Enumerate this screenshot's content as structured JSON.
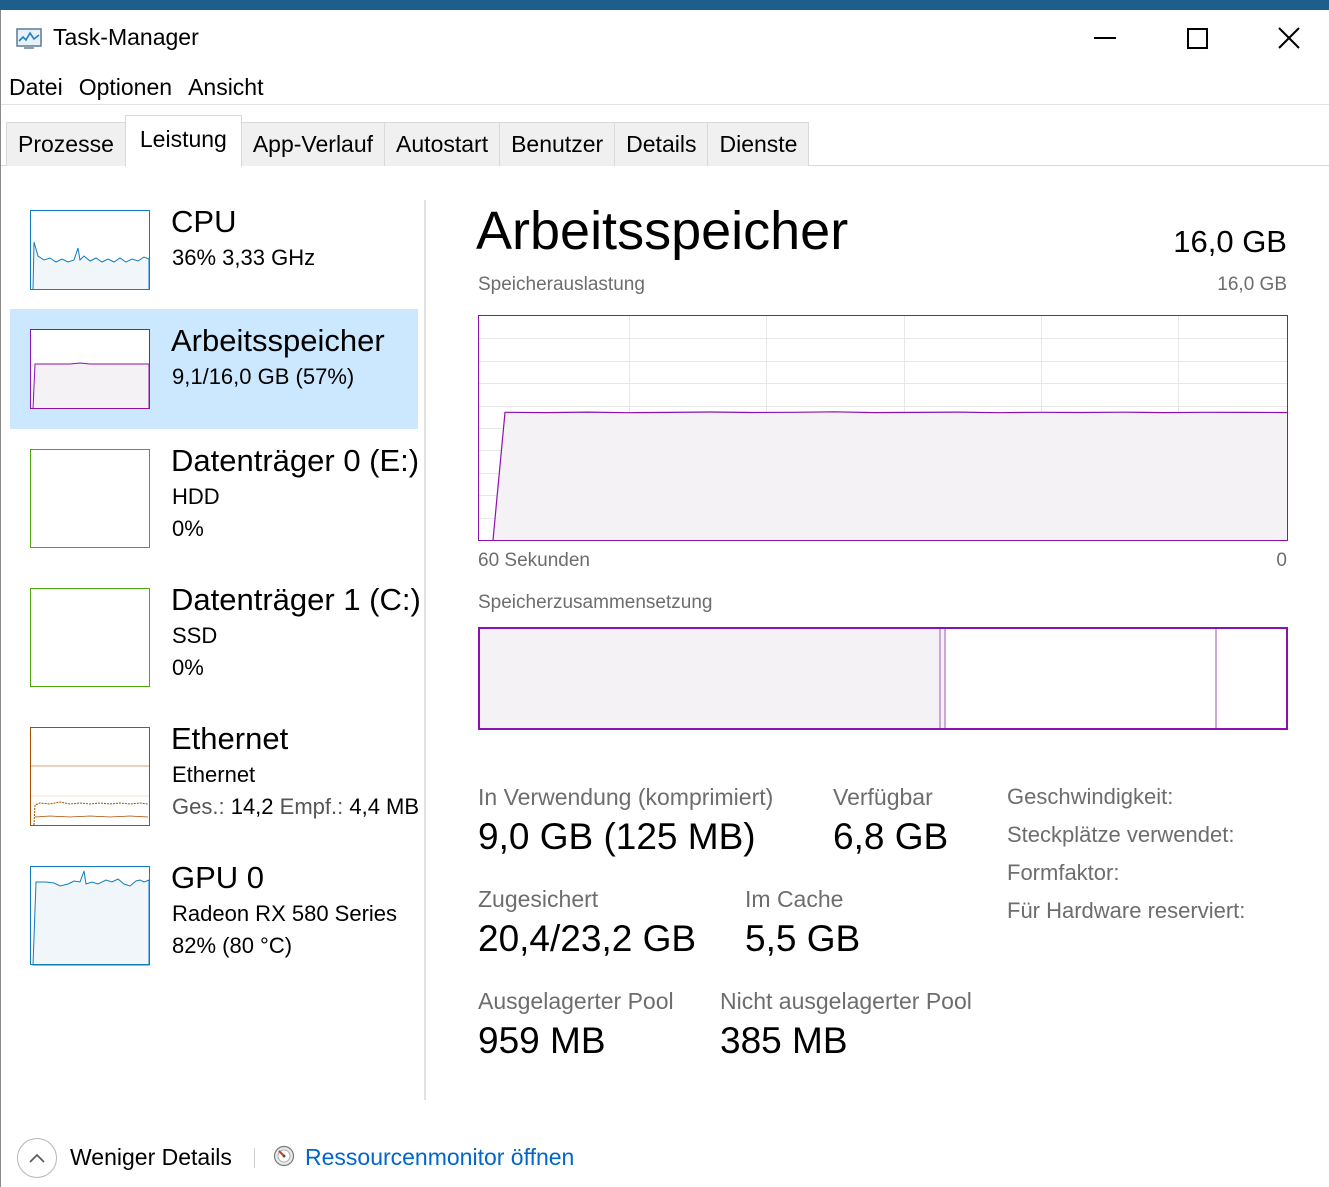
{
  "window": {
    "title": "Task-Manager",
    "minimize_label": "",
    "maximize_label": "",
    "close_label": ""
  },
  "menu": [
    "Datei",
    "Optionen",
    "Ansicht"
  ],
  "tabs": [
    {
      "label": "Prozesse",
      "active": false
    },
    {
      "label": "Leistung",
      "active": true
    },
    {
      "label": "App-Verlauf",
      "active": false
    },
    {
      "label": "Autostart",
      "active": false
    },
    {
      "label": "Benutzer",
      "active": false
    },
    {
      "label": "Details",
      "active": false
    },
    {
      "label": "Dienste",
      "active": false
    }
  ],
  "sidebar": {
    "items": [
      {
        "name": "CPU",
        "sub1": "36%  3,33 GHz",
        "sub2": "",
        "color": "#117dbb",
        "fill": "#f1f6fa"
      },
      {
        "name": "Arbeitsspeicher",
        "sub1": "9,1/16,0 GB (57%)",
        "sub2": "",
        "color": "#8b12ae",
        "fill": "#f4f2f4",
        "selected": true
      },
      {
        "name": "Datenträger 0 (E:)",
        "sub1": "HDD",
        "sub2": "0%",
        "color": "#4da60c",
        "fill": "#ffffff"
      },
      {
        "name": "Datenträger 1 (C:)",
        "sub1": "SSD",
        "sub2": "0%",
        "color": "#4da60c",
        "fill": "#ffffff"
      },
      {
        "name": "Ethernet",
        "sub1": "Ethernet",
        "sub2_parts": {
          "ges_label": "Ges.:",
          "ges_value": "14,2",
          "empf_label": "Empf.:",
          "empf_value": "4,4 MB"
        },
        "color": "#a74f01",
        "fill": "#ffffff"
      },
      {
        "name": "GPU 0",
        "sub1": "Radeon RX 580 Series",
        "sub2": "82%  (80 °C)",
        "color": "#117dbb",
        "fill": "#f1f6fa"
      }
    ]
  },
  "main": {
    "title": "Arbeitsspeicher",
    "total": "16,0 GB",
    "usage_label": "Speicherauslastung",
    "usage_max": "16,0 GB",
    "time_left": "60 Sekunden",
    "time_right": "0",
    "composition_label": "Speicherzusammensetzung",
    "usage_level_fraction": 0.57,
    "stats": {
      "in_use_label": "In Verwendung (komprimiert)",
      "in_use_value": "9,0 GB (125 MB)",
      "available_label": "Verfügbar",
      "available_value": "6,8 GB",
      "committed_label": "Zugesichert",
      "committed_value": "20,4/23,2 GB",
      "cached_label": "Im Cache",
      "cached_value": "5,5 GB",
      "paged_label": "Ausgelagerter Pool",
      "paged_value": "959 MB",
      "nonpaged_label": "Nicht ausgelagerter Pool",
      "nonpaged_value": "385 MB"
    },
    "specs": {
      "speed_label": "Geschwindigkeit:",
      "slots_label": "Steckplätze verwendet:",
      "form_label": "Formfaktor:",
      "reserved_label": "Für Hardware reserviert:"
    }
  },
  "footer": {
    "less_details": "Weniger Details",
    "resource_monitor": "Ressourcenmonitor öffnen"
  },
  "colors": {
    "memory": "#8b12ae",
    "selection": "#cce8ff",
    "link": "#0066cc"
  }
}
